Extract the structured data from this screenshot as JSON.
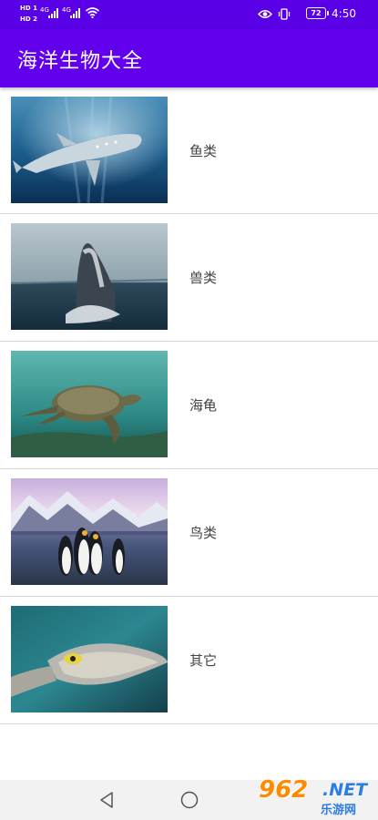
{
  "status_bar": {
    "hd1": "HD 1",
    "hd2": "HD 2",
    "net1": "4G",
    "net2": "4G",
    "battery": "72",
    "time": "4:50"
  },
  "app_bar": {
    "title": "海洋生物大全"
  },
  "list": {
    "items": [
      {
        "label": "鱼类",
        "image": "whale-shark-photo"
      },
      {
        "label": "兽类",
        "image": "humpback-whale-photo"
      },
      {
        "label": "海龟",
        "image": "sea-turtle-photo"
      },
      {
        "label": "鸟类",
        "image": "penguins-photo"
      },
      {
        "label": "其它",
        "image": "cuttlefish-photo"
      }
    ]
  },
  "nav_bar": {
    "back": "back-icon",
    "home": "home-icon"
  },
  "watermark": {
    "number": "962",
    "suffix": ".NET",
    "sub": "乐游网"
  }
}
